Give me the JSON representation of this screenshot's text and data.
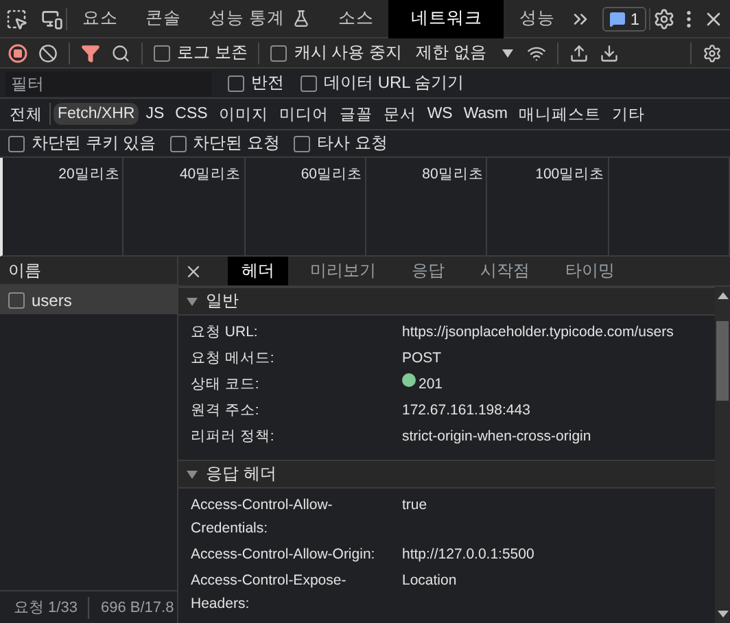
{
  "panel_tabs": [
    {
      "label": "요소",
      "selected": false,
      "kind": "plain"
    },
    {
      "label": "콘솔",
      "selected": false,
      "kind": "plain"
    },
    {
      "label": "성능 통계",
      "selected": false,
      "kind": "experimental"
    },
    {
      "label": "소스",
      "selected": false,
      "kind": "plain"
    },
    {
      "label": "네트워크",
      "selected": true,
      "kind": "plain"
    },
    {
      "label": "성능",
      "selected": false,
      "kind": "plain"
    }
  ],
  "issues_badge": "1",
  "toolbar": {
    "recording": true,
    "preserve_log": {
      "label": "로그 보존",
      "checked": false
    },
    "disable_cache": {
      "label": "캐시 사용 중지",
      "checked": false
    },
    "throttling": "제한 없음"
  },
  "filter": {
    "placeholder": "필터",
    "invert": {
      "label": "반전",
      "checked": false
    },
    "hide_data_urls": {
      "label": "데이터 URL 숨기기",
      "checked": false
    }
  },
  "type_filters": [
    {
      "label": "전체",
      "selected": false
    },
    {
      "label": "Fetch/XHR",
      "selected": true
    },
    {
      "label": "JS",
      "selected": false
    },
    {
      "label": "CSS",
      "selected": false
    },
    {
      "label": "이미지",
      "selected": false
    },
    {
      "label": "미디어",
      "selected": false
    },
    {
      "label": "글꼴",
      "selected": false
    },
    {
      "label": "문서",
      "selected": false
    },
    {
      "label": "WS",
      "selected": false
    },
    {
      "label": "Wasm",
      "selected": false
    },
    {
      "label": "매니페스트",
      "selected": false
    },
    {
      "label": "기타",
      "selected": false
    }
  ],
  "more_filters": [
    {
      "label": "차단된 쿠키 있음",
      "checked": false
    },
    {
      "label": "차단된 요청",
      "checked": false
    },
    {
      "label": "타사 요청",
      "checked": false
    }
  ],
  "timeline": {
    "ticks": [
      "20밀리초",
      "40밀리초",
      "60밀리초",
      "80밀리초",
      "100밀리초"
    ]
  },
  "requests": {
    "column": "이름",
    "rows": [
      {
        "name": "users",
        "selected": true,
        "checked": false
      }
    ]
  },
  "status_bar": {
    "requests": "요청 1/33",
    "transferred": "696 B/17.8"
  },
  "detail_tabs": [
    {
      "label": "헤더",
      "selected": true
    },
    {
      "label": "미리보기",
      "selected": false
    },
    {
      "label": "응답",
      "selected": false
    },
    {
      "label": "시작점",
      "selected": false
    },
    {
      "label": "타이밍",
      "selected": false
    }
  ],
  "sections": [
    {
      "title": "일반",
      "expanded": true,
      "rows": [
        {
          "name": "요청 URL:",
          "value": "https://jsonplaceholder.typicode.com/users"
        },
        {
          "name": "요청 메서드:",
          "value": "POST"
        },
        {
          "name": "상태 코드:",
          "value": "201",
          "color": "#81c995"
        },
        {
          "name": "원격 주소:",
          "value": "172.67.161.198:443"
        },
        {
          "name": "리퍼러 정책:",
          "value": "strict-origin-when-cross-origin"
        }
      ]
    },
    {
      "title": "응답 헤더",
      "expanded": true,
      "rows": [
        {
          "name": "Access-Control-Allow-Credentials:",
          "value": "true"
        },
        {
          "name": "Access-Control-Allow-Origin:",
          "value": "http://127.0.0.1:5500"
        },
        {
          "name": "Access-Control-Expose-Headers:",
          "value": "Location"
        }
      ]
    }
  ]
}
